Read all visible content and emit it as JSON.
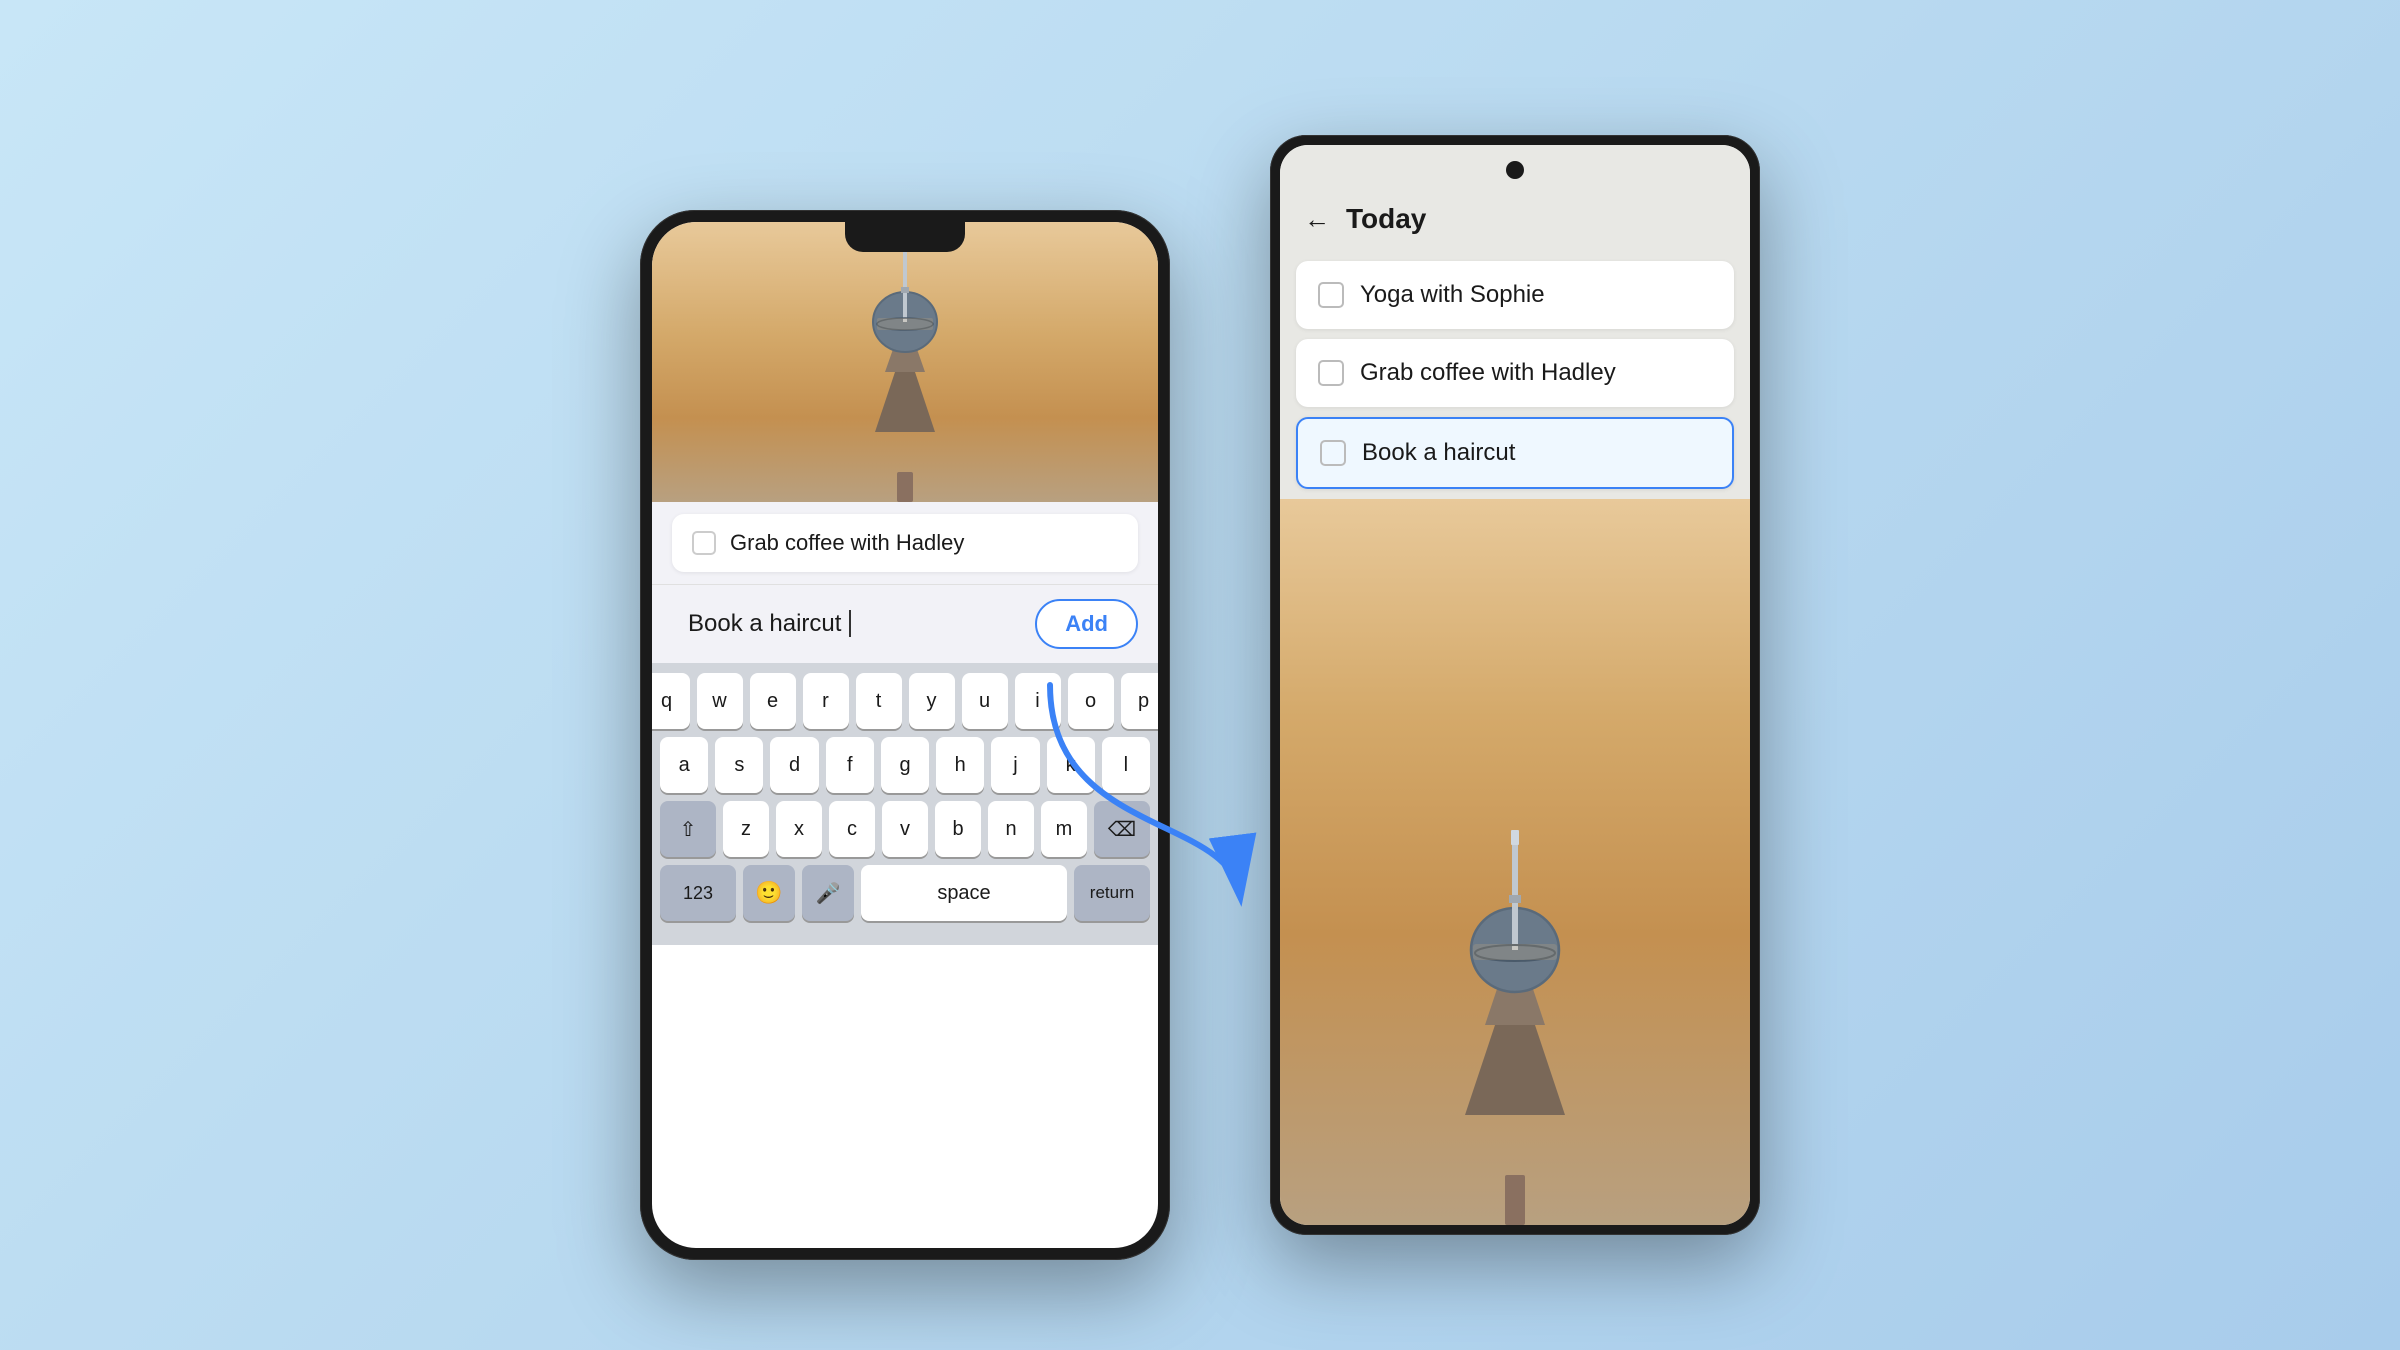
{
  "background": "#c0ddf0",
  "iphone": {
    "task1": "Grab coffee with Hadley",
    "input_value": "Book a haircut",
    "input_cursor": "|",
    "add_button": "Add",
    "keyboard": {
      "row1": [
        "q",
        "w",
        "e",
        "r",
        "t",
        "y",
        "u",
        "i",
        "o",
        "p"
      ],
      "row2": [
        "a",
        "s",
        "d",
        "f",
        "g",
        "h",
        "j",
        "k",
        "l"
      ],
      "row3": [
        "z",
        "x",
        "c",
        "v",
        "b",
        "n",
        "m"
      ],
      "space": "space",
      "return": "return",
      "num": "123",
      "emoji": "🙂",
      "mic": "🎤",
      "shift": "⇧",
      "delete": "⌫"
    }
  },
  "android": {
    "title": "Today",
    "back_label": "←",
    "task1": "Yoga with Sophie",
    "task2": "Grab coffee with Hadley",
    "task3": "Book a haircut"
  }
}
